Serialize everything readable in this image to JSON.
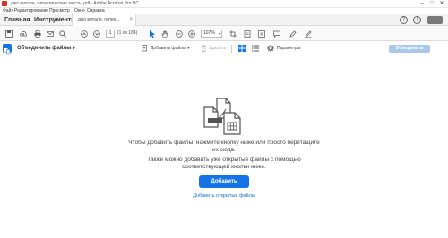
{
  "window": {
    "title": "джо витале, гипнотические тексты.pdf - Adobe Acrobat Pro DC",
    "minimize": "–",
    "maximize": "□",
    "close": "✕"
  },
  "menu": [
    "Файл",
    "Редактирование",
    "Просмотр",
    "Окно",
    "Справка"
  ],
  "tabs": {
    "home": "Главная",
    "tools": "Инструменты",
    "document": "джо витале, гипно...",
    "document_close": "×"
  },
  "toolbar": {
    "page_current": "1",
    "page_count": "(1 из 184)",
    "zoom": "107%",
    "zoom_arrow": "▾"
  },
  "actionbar": {
    "title": "Объединить файлы",
    "title_arrow": "▾",
    "add_files": "Добавить файлы",
    "add_files_arrow": "▾",
    "delete": "Удалить",
    "settings": "Параметры",
    "combine": "Объединить"
  },
  "content": {
    "instruction_line1": "Чтобы добавить файлы, нажмите кнопку ниже или просто перетащите",
    "instruction_line2": "их сюда.",
    "instruction_line3": "Также можно добавить уже открытые файлы с помощью",
    "instruction_line4": "соответствующей кнопки ниже.",
    "add_button": "Добавить",
    "add_open_link": "Добавить открытые файлы"
  },
  "colors": {
    "accent": "#1473e6",
    "combine_disabled": "#a9c8ec",
    "brand_red": "#d9302a"
  }
}
